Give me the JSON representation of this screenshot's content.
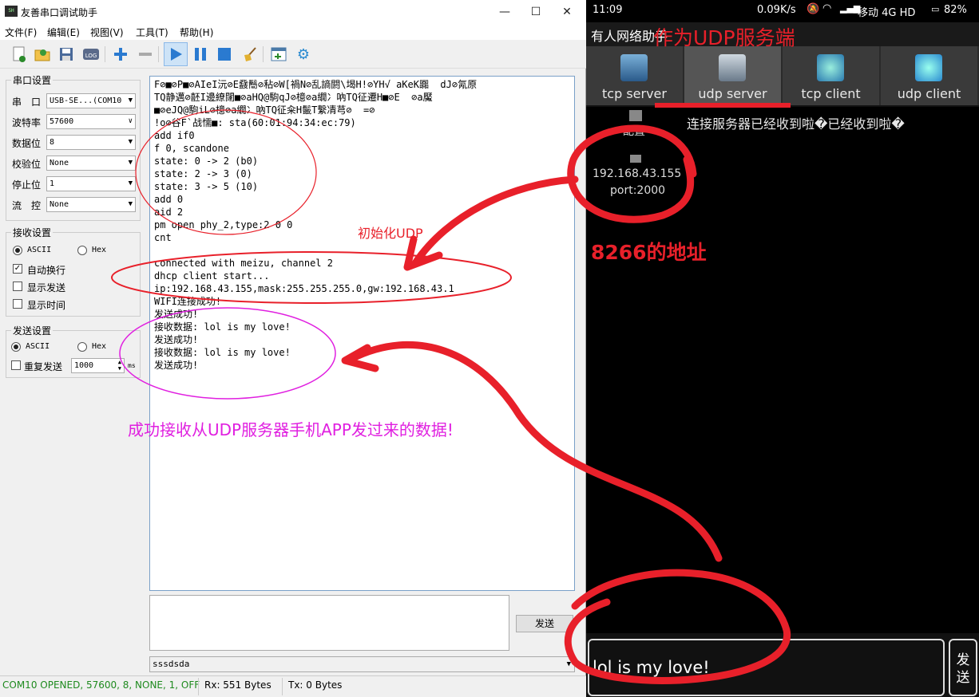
{
  "window": {
    "title": "友善串口调试助手",
    "icon_text": "SH",
    "minimize": "—",
    "maximize": "☐",
    "close": "✕"
  },
  "menu": [
    "文件(F)",
    "编辑(E)",
    "视图(V)",
    "工具(T)",
    "帮助(H)"
  ],
  "toolbar": {
    "log_label": "LOG"
  },
  "serial": {
    "group_title": "串口设置",
    "port_label": "串　口",
    "port_value": "USB-SE...(COM10",
    "baud_label": "波特率",
    "baud_value": "57600",
    "data_label": "数据位",
    "data_value": "8",
    "parity_label": "校验位",
    "parity_value": "None",
    "stop_label": "停止位",
    "stop_value": "1",
    "flow_label": "流　控",
    "flow_value": "None"
  },
  "receive": {
    "group_title": "接收设置",
    "ascii": "ASCII",
    "hex": "Hex",
    "auto_wrap": "自动换行",
    "show_send": "显示发送",
    "show_time": "显示时间"
  },
  "send": {
    "group_title": "发送设置",
    "ascii": "ASCII",
    "hex": "Hex",
    "repeat": "重复发送",
    "interval": "1000",
    "unit": "ms",
    "button": "发送",
    "history_value": "sssdsda"
  },
  "recv_lines": [
    "F⊘■⊘P■⊘AIeI沅⊘E鼗鬝⊘秥⊘W[禍N⊘乱謪閼\\堨H!⊘YH√ aKeK嚻  dJ⊘氝原",
    "TQ静邁⊘噽I邊繚闥■⊘aHQ@駒qJ⊘檍⊘a繝冫吶TQ征遷H■⊘E  ⊘a魘",
    "■⊘eJQ@駒iL⊘檍⊘a繝冫吶TQ征籴H鬛T繫凊芎⊘  =⊘",
    "!o⊘谷F`战懦■: sta(60:01:94:34:ec:79)",
    "add if0",
    "f 0, scandone",
    "state: 0 -> 2 (b0)",
    "state: 2 -> 3 (0)",
    "state: 3 -> 5 (10)",
    "add 0",
    "aid 2",
    "pm open phy_2,type:2 0 0",
    "cnt",
    "",
    "connected with meizu, channel 2",
    "dhcp client start...",
    "ip:192.168.43.155,mask:255.255.255.0,gw:192.168.43.1",
    "WIFI连接成功!",
    "发送成功!",
    "接收数据: lol is my love!",
    "发送成功!",
    "接收数据: lol is my love!",
    "发送成功!"
  ],
  "status": {
    "port": "COM10 OPENED, 57600, 8, NONE, 1, OFF",
    "rx": "Rx: 551 Bytes",
    "tx": "Tx: 0 Bytes"
  },
  "phone": {
    "time": "11:09",
    "net_speed": "0.09K/s",
    "carrier": "移动 4G HD",
    "battery": "82%",
    "app_title": "有人网络助手",
    "tabs": [
      "tcp server",
      "udp server",
      "tcp client",
      "udp client"
    ],
    "config_label": "配置",
    "message": "连接服务器已经收到啦�已经收到啦�",
    "ip": "192.168.43.155",
    "port": "port:2000",
    "input_value": "lol is my love!",
    "send_button": "发送"
  },
  "annotations": {
    "udp_server_note": "作为UDP服务端",
    "init_udp": "初始化UDP",
    "address_8266": "8266的地址",
    "received_note": "成功接收从UDP服务器手机APP发过来的数据!"
  },
  "colors": {
    "status_green": "#1e8a1e",
    "annot_red": "#e8202a",
    "annot_magenta": "#e020e0"
  }
}
